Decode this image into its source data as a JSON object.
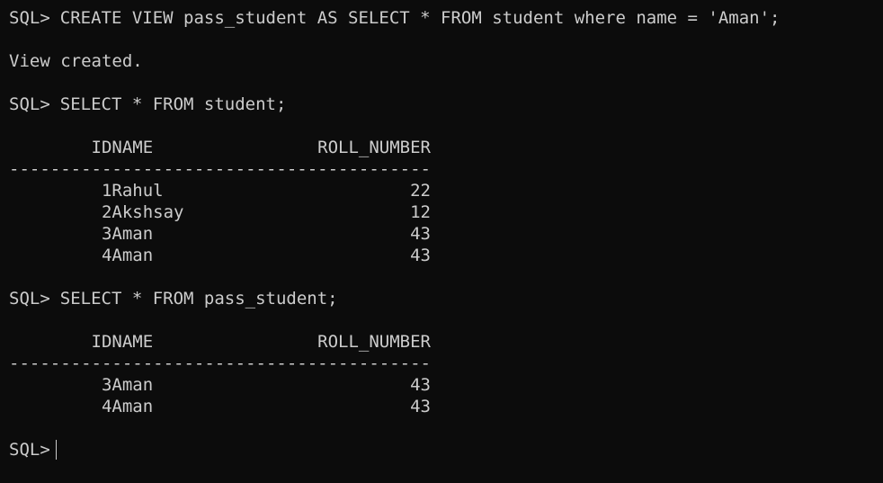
{
  "terminal": {
    "prompt": "SQL>",
    "command_create_view": "CREATE VIEW pass_student AS SELECT * FROM student where name = 'Aman';",
    "view_created": "View created.",
    "command_select_student": "SELECT * FROM student;",
    "command_select_pass_student": "SELECT * FROM pass_student;",
    "student_table": {
      "columns": [
        "ID",
        "NAME",
        "ROLL_NUMBER"
      ],
      "underline": [
        "----------",
        "--------------------",
        "-----------"
      ],
      "rows": [
        [
          "1",
          "Rahul",
          "22"
        ],
        [
          "2",
          "Akshsay",
          "12"
        ],
        [
          "3",
          "Aman",
          "43"
        ],
        [
          "4",
          "Aman",
          "43"
        ]
      ]
    },
    "pass_student_table": {
      "columns": [
        "ID",
        "NAME",
        "ROLL_NUMBER"
      ],
      "underline": [
        "----------",
        "--------------------",
        "-----------"
      ],
      "rows": [
        [
          "3",
          "Aman",
          "43"
        ],
        [
          "4",
          "Aman",
          "43"
        ]
      ]
    }
  }
}
